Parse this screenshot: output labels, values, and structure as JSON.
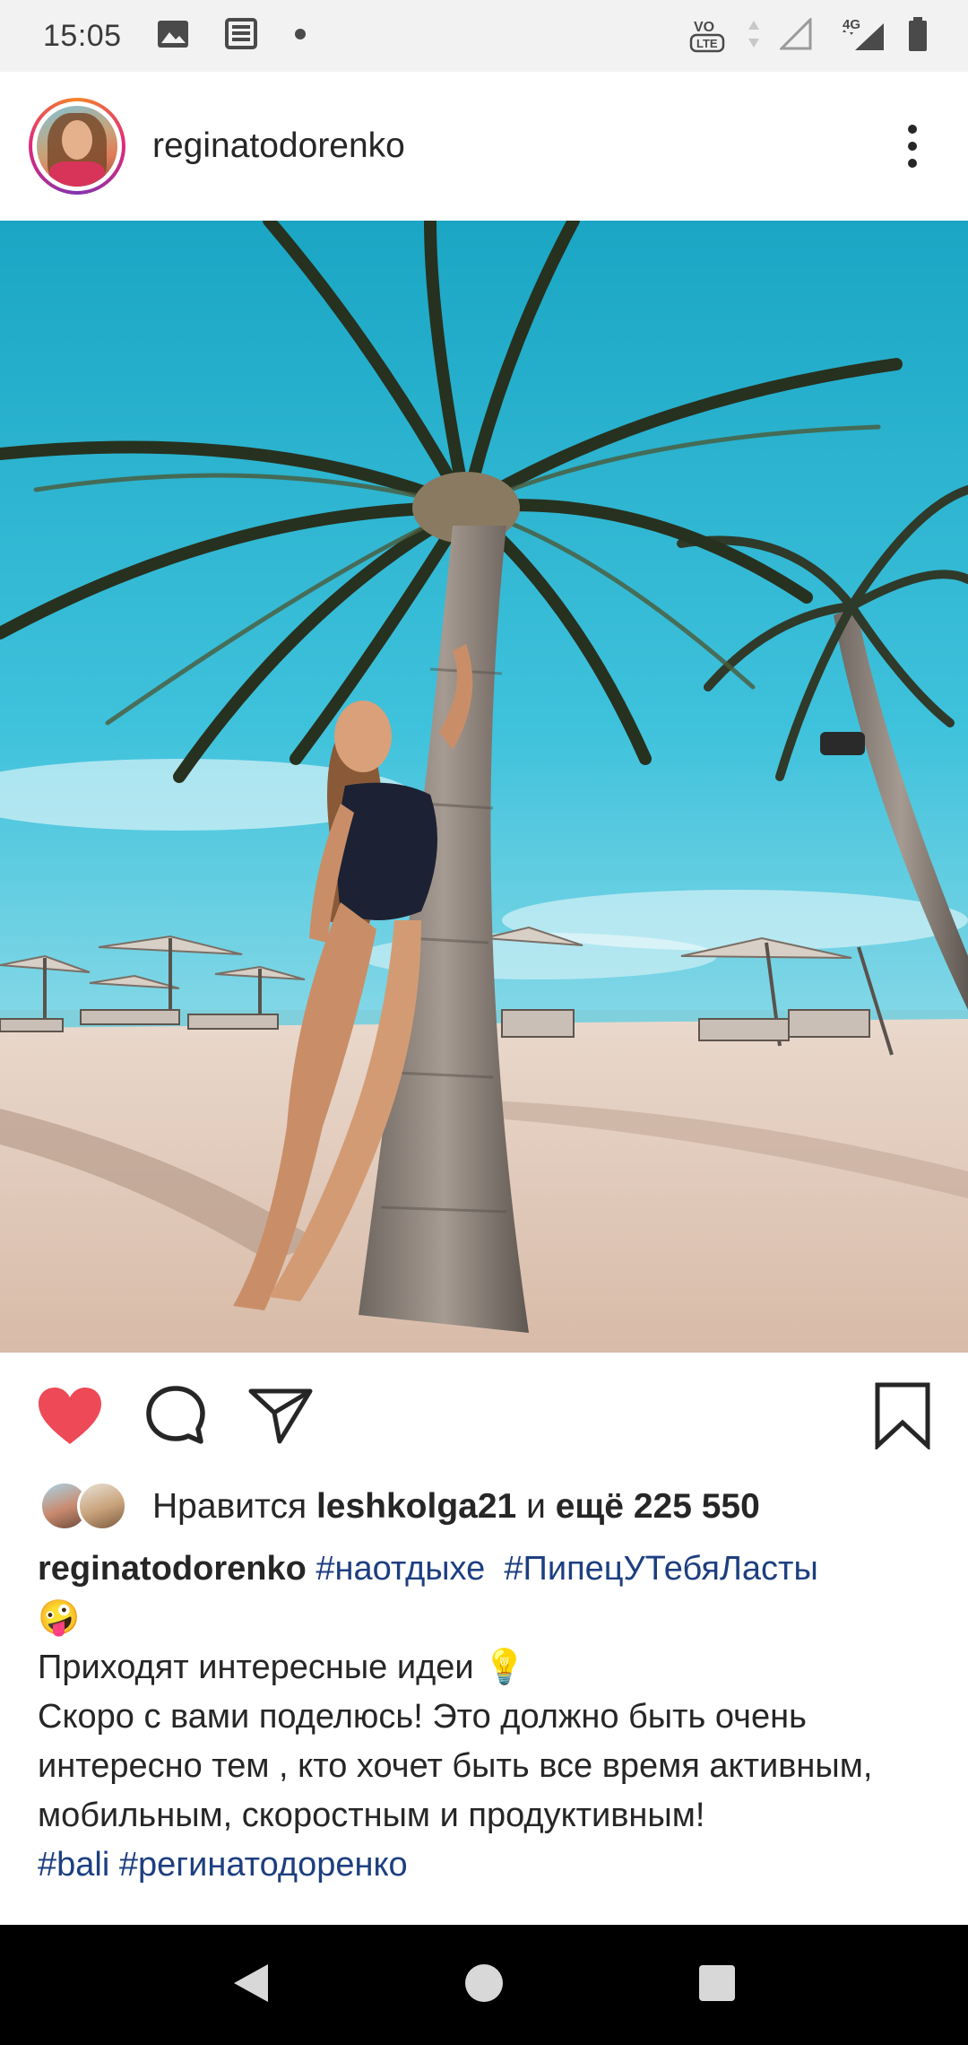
{
  "status_bar": {
    "time": "15:05",
    "left_icons": [
      "image-icon",
      "news-icon",
      "dot-icon"
    ],
    "right_icons": [
      "volte-icon",
      "data-arrows-icon",
      "signal-empty-icon",
      "signal-4g-icon",
      "battery-icon"
    ],
    "network_label": "4G",
    "volte_label": "VO LTE"
  },
  "post": {
    "username": "reginatodorenko",
    "photo_description_icon": "beach-photo"
  },
  "actions": {
    "like_icon": "heart-filled-icon",
    "comment_icon": "comment-icon",
    "share_icon": "paper-plane-icon",
    "save_icon": "bookmark-icon",
    "like_color": "#ed4956"
  },
  "likes": {
    "prefix": "Нравится",
    "user": "leshkolga21",
    "middle": "и",
    "more": "ещё 225 550"
  },
  "caption": {
    "username": "reginatodorenko",
    "hashtag_1": "#наотдыхе",
    "hashtag_2": "#ПипецУТебяЛасты",
    "emoji_1": "🤪",
    "line_1": "Приходят интересные идеи",
    "emoji_2": "💡",
    "line_2": "Скоро с вами поделюсь! Это должно быть очень интересно тем , кто хочет быть все время активным, мобильным, скоростным и продуктивным!",
    "hashtag_3": "#bali",
    "hashtag_4": "#регинатодоренко",
    "hashtag_color": "#1d3f80"
  },
  "nav_bar": {
    "back_icon": "back-triangle-icon",
    "home_icon": "home-circle-icon",
    "recents_icon": "recents-square-icon"
  }
}
